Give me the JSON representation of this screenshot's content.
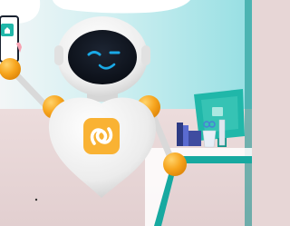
{
  "scene": {
    "subject": "robot-mascot-illustration",
    "setting": "office-desk",
    "colors": {
      "wall": "#a8e4e8",
      "wall_light": "#dff5f6",
      "floor": "#e5d3d3",
      "robot_body": "#f1f1f1",
      "robot_shadow": "#d2d2d2",
      "visor": "#121823",
      "eye_glow": "#1aa9e6",
      "joint_orange": "#f6a623",
      "logo_badge": "#f9b233",
      "desk_teal": "#17a9a0",
      "monitor_teal": "#20b7a9",
      "books_navy": "#2e3b84",
      "books_blue": "#5a6bd0"
    }
  }
}
